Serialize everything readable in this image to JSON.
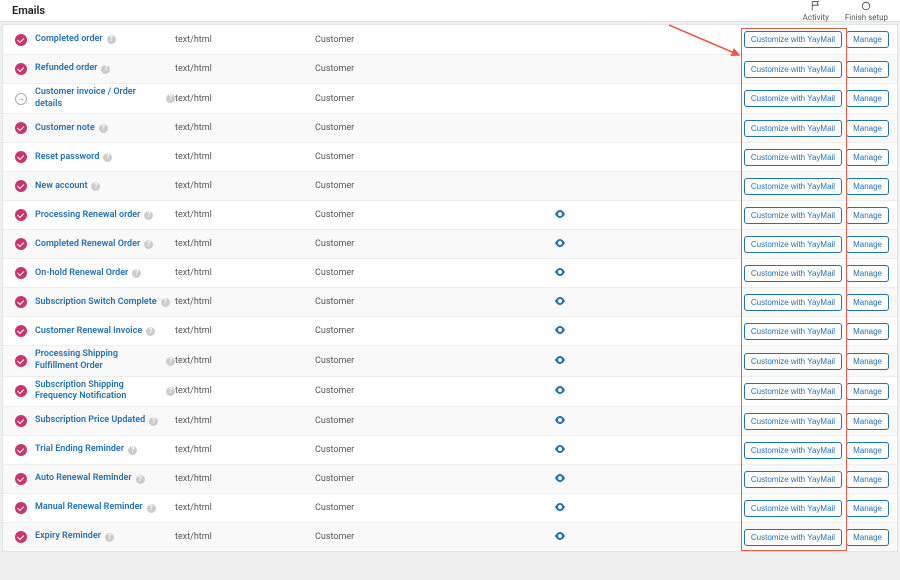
{
  "topbar": {
    "title": "Emails",
    "activity_label": "Activity",
    "finish_label": "Finish setup"
  },
  "buttons": {
    "customize": "Customize with YayMail",
    "manage": "Manage"
  },
  "common": {
    "content_type": "text/html",
    "recipient": "Customer"
  },
  "rows": [
    {
      "name": "Completed order",
      "status": "check",
      "eye": false
    },
    {
      "name": "Refunded order",
      "status": "check",
      "eye": false
    },
    {
      "name": "Customer invoice / Order details",
      "status": "manual",
      "eye": false
    },
    {
      "name": "Customer note",
      "status": "check",
      "eye": false
    },
    {
      "name": "Reset password",
      "status": "check",
      "eye": false
    },
    {
      "name": "New account",
      "status": "check",
      "eye": false
    },
    {
      "name": "Processing Renewal order",
      "status": "check",
      "eye": true
    },
    {
      "name": "Completed Renewal Order",
      "status": "check",
      "eye": true
    },
    {
      "name": "On-hold Renewal Order",
      "status": "check",
      "eye": true
    },
    {
      "name": "Subscription Switch Complete",
      "status": "check",
      "eye": true
    },
    {
      "name": "Customer Renewal Invoice",
      "status": "check",
      "eye": true
    },
    {
      "name": "Processing Shipping Fulfillment Order",
      "status": "check",
      "eye": true,
      "multiline": true
    },
    {
      "name": "Subscription Shipping Frequency Notification",
      "status": "check",
      "eye": true,
      "multiline": true
    },
    {
      "name": "Subscription Price Updated",
      "status": "check",
      "eye": true
    },
    {
      "name": "Trial Ending Reminder",
      "status": "check",
      "eye": true
    },
    {
      "name": "Auto Renewal Reminder",
      "status": "check",
      "eye": true
    },
    {
      "name": "Manual Renewal Reminder",
      "status": "check",
      "eye": true
    },
    {
      "name": "Expiry Reminder",
      "status": "check",
      "eye": true
    }
  ]
}
